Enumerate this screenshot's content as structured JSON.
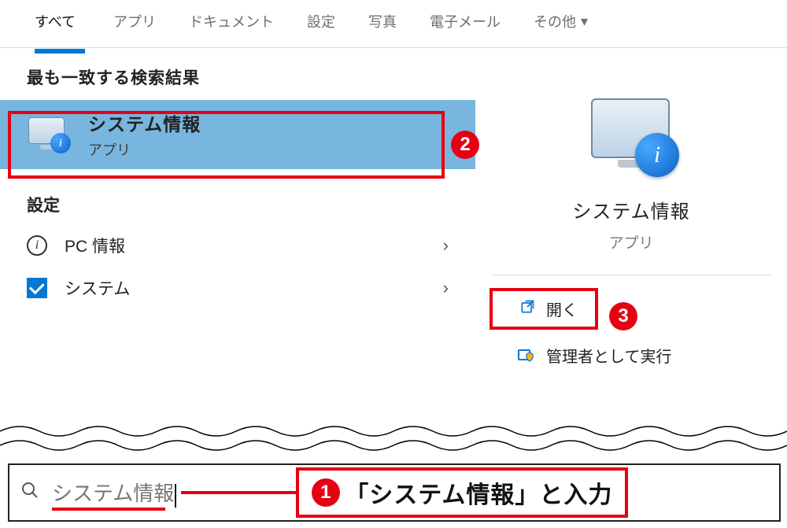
{
  "tabs": {
    "all": "すべて",
    "apps": "アプリ",
    "documents": "ドキュメント",
    "settings": "設定",
    "photos": "写真",
    "email": "電子メール",
    "more": "その他"
  },
  "best_match_header": "最も一致する検索結果",
  "best_match": {
    "title": "システム情報",
    "subtitle": "アプリ"
  },
  "settings_header": "設定",
  "setting_items": {
    "pc_info": "PC 情報",
    "system": "システム"
  },
  "preview": {
    "title": "システム情報",
    "subtitle": "アプリ"
  },
  "actions": {
    "open": "開く",
    "run_admin": "管理者として実行"
  },
  "search": {
    "query": "システム情報"
  },
  "instruction": "「システム情報」と入力",
  "callouts": {
    "one": "1",
    "two": "2",
    "three": "3"
  }
}
